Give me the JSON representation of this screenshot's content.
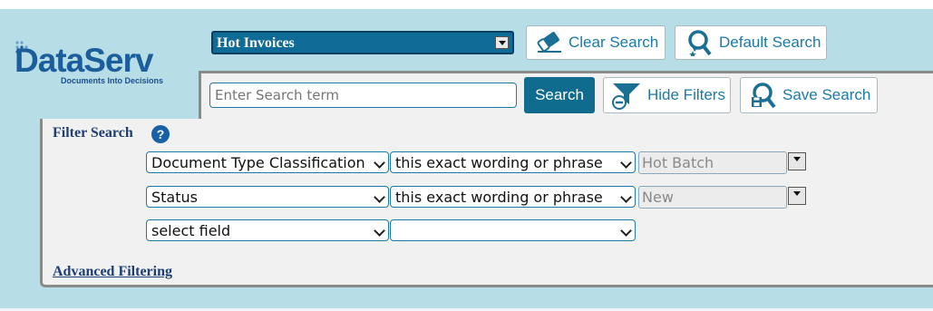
{
  "logo": {
    "brand": "DataServ",
    "tagline": "Documents Into Decisions"
  },
  "saved_search": {
    "selected": "Hot Invoices"
  },
  "toolbar": {
    "clear_search": "Clear Search",
    "default_search": "Default Search",
    "search": "Search",
    "hide_filters": "Hide Filters",
    "save_search": "Save Search"
  },
  "search": {
    "placeholder": "Enter Search term",
    "value": ""
  },
  "filters": {
    "title": "Filter Search",
    "help": "?",
    "rows": [
      {
        "field": "Document Type Classification",
        "operator": "this exact wording or phrase",
        "value": "Hot Batch"
      },
      {
        "field": "Status",
        "operator": "this exact wording or phrase",
        "value": "New"
      },
      {
        "field": "select field",
        "operator": "",
        "value": ""
      }
    ],
    "advanced_link": "Advanced Filtering"
  },
  "colors": {
    "background": "#b7dde7",
    "primary": "#0f6c8e",
    "link": "#1d3e73",
    "accent": "#1a7aa8"
  }
}
